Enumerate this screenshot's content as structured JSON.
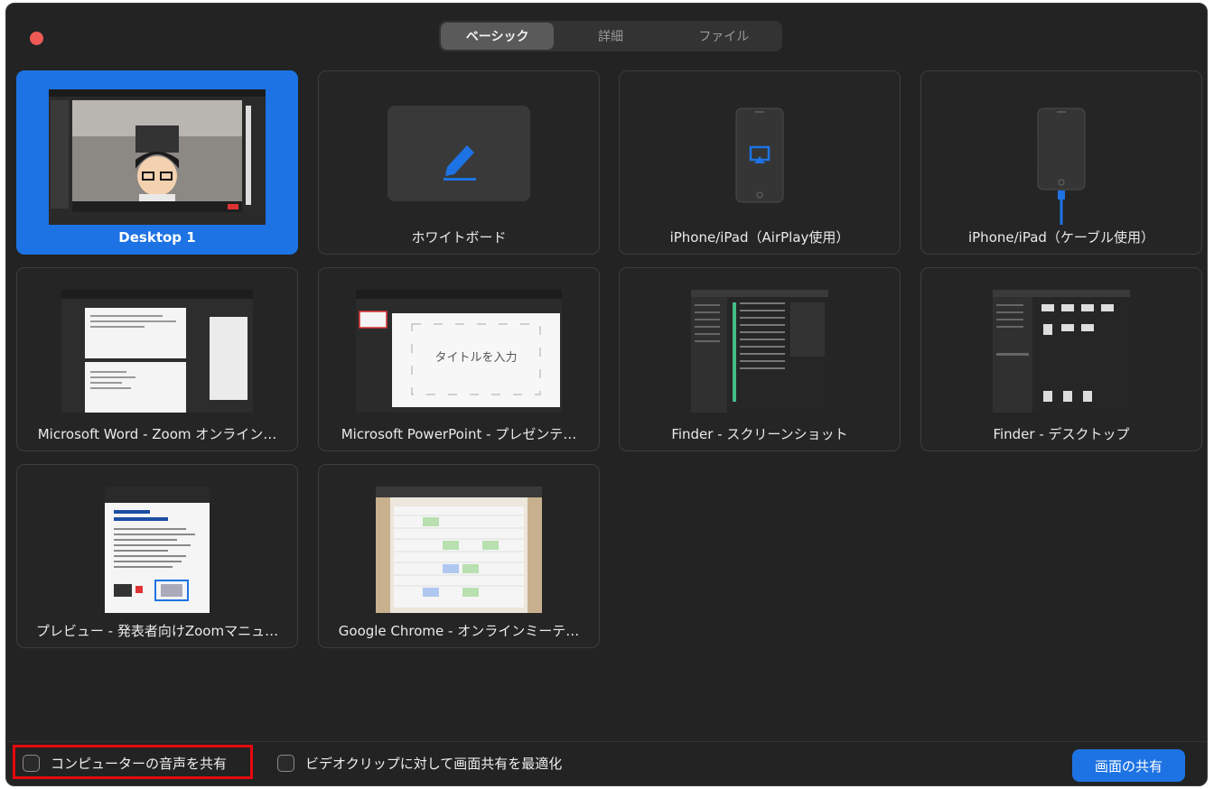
{
  "tabs": [
    {
      "label": "ベーシック",
      "active": true
    },
    {
      "label": "詳細",
      "active": false
    },
    {
      "label": "ファイル",
      "active": false
    }
  ],
  "tiles": [
    {
      "label": "Desktop 1",
      "selected": true
    },
    {
      "label": "ホワイトボード",
      "selected": false
    },
    {
      "label": "iPhone/iPad（AirPlay使用）",
      "selected": false
    },
    {
      "label": "iPhone/iPad（ケーブル使用）",
      "selected": false
    },
    {
      "label": "Microsoft Word - Zoom オンライン…",
      "selected": false
    },
    {
      "label": "Microsoft PowerPoint - プレゼンテ…",
      "selected": false
    },
    {
      "label": "Finder - スクリーンショット",
      "selected": false
    },
    {
      "label": "Finder - デスクトップ",
      "selected": false
    },
    {
      "label": "プレビュー - 発表者向けZoomマニュ…",
      "selected": false
    },
    {
      "label": "Google Chrome - オンラインミーテ…",
      "selected": false
    }
  ],
  "powerpoint_thumb": {
    "title": "タイトルを入力"
  },
  "bottom": {
    "share_audio_label": "コンピューターの音声を共有",
    "optimize_video_label": "ビデオクリップに対して画面共有を最適化",
    "share_button_label": "画面の共有"
  },
  "colors": {
    "accent": "#1d73e3",
    "highlight": "#e5090f",
    "close": "#ee5a55"
  }
}
